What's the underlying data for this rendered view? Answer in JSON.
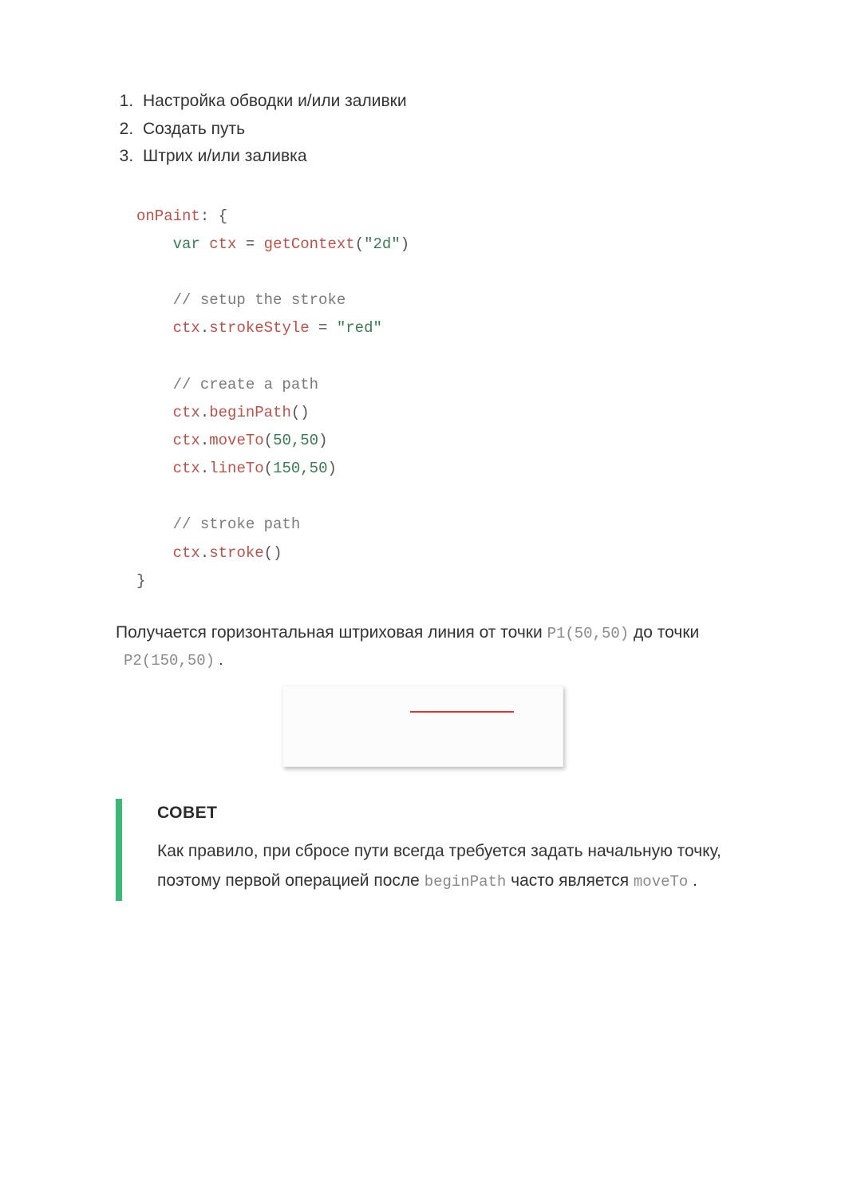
{
  "steps": [
    "Настройка обводки и/или заливки",
    "Создать путь",
    "Штрих и/или заливка"
  ],
  "code": {
    "onPaint": "onPaint",
    "colon_brace": ": {",
    "var": "var",
    "ctx": "ctx",
    "eq": " = ",
    "getContext": "getContext",
    "lp": "(",
    "rp": ")",
    "str_2d": "\"2d\"",
    "c_setup": "// setup the stroke",
    "strokeStyle": "strokeStyle",
    "str_red": "\"red\"",
    "c_path": "// create a path",
    "beginPath": "beginPath",
    "moveTo": "moveTo",
    "lineTo": "lineTo",
    "args_50_50": "50,50",
    "args_150_50": "150,50",
    "c_stroke": "// stroke path",
    "stroke": "stroke",
    "close": "}",
    "dot": "."
  },
  "para": {
    "pre": "Получается горизонтальная штриховая линия от точки ",
    "p1": "P1(50,50)",
    "mid": " до точки",
    "p2": "P2(150,50)",
    "p2_suffix": " ."
  },
  "tip": {
    "title": "СОВЕТ",
    "t1": "Как правило, при сбросе пути всегда требуется задать начальную точку, поэтому первой операцией после ",
    "beginPath": "beginPath",
    "t2": " часто является ",
    "moveTo": "moveTo",
    "t3": " ."
  }
}
